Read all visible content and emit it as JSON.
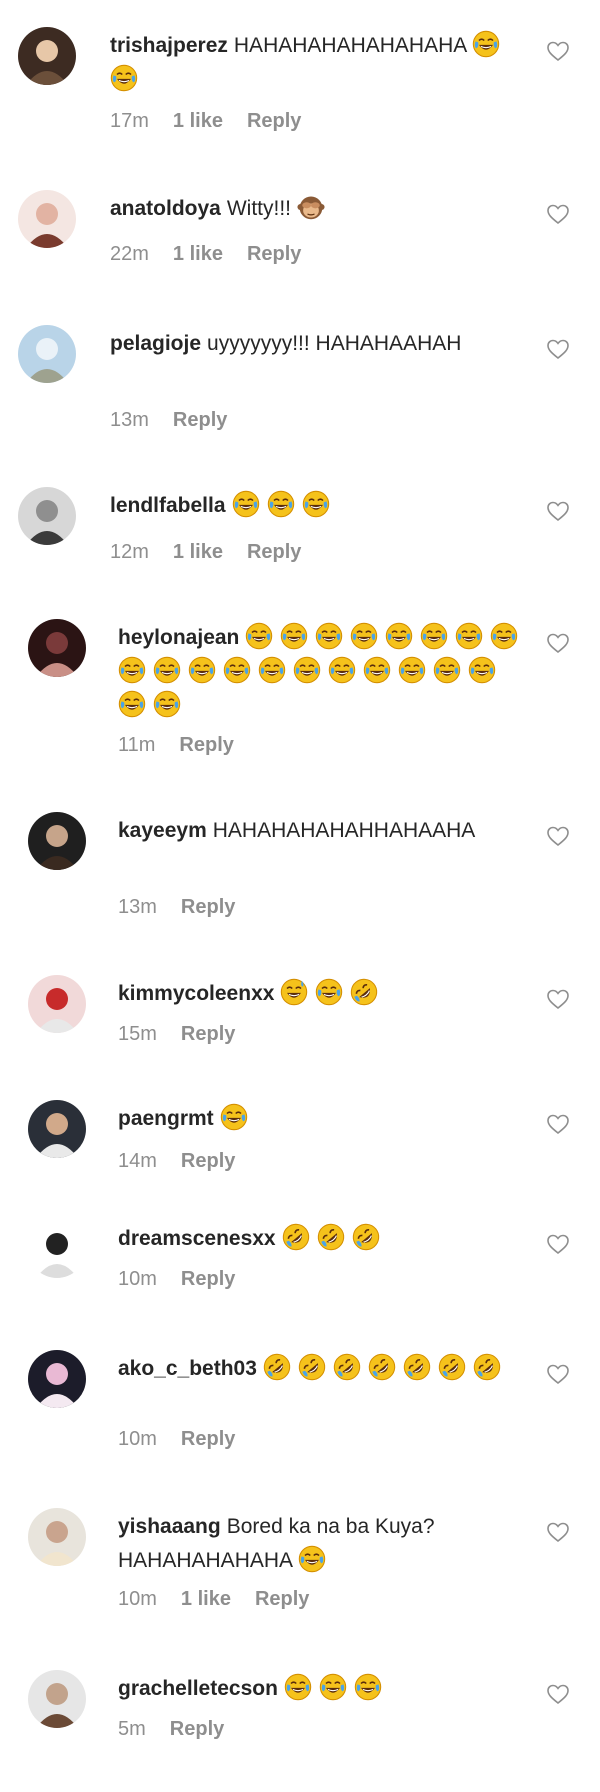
{
  "colors": {
    "text": "#262626",
    "meta": "#8e8e8e",
    "emoji_face": "#f5c21b",
    "emoji_outline": "#d48f00",
    "tear": "#4aa3e8"
  },
  "comments": [
    {
      "username": "trishajperez",
      "text": "HAHAHAHAHAHAHAHA",
      "emojis": [
        "joy",
        "joy"
      ],
      "time": "17m",
      "likes": "1 like",
      "reply": "Reply"
    },
    {
      "username": "anatoldoya",
      "text": "Witty!!!",
      "emojis": [
        "see-no-evil"
      ],
      "time": "22m",
      "likes": "1 like",
      "reply": "Reply"
    },
    {
      "username": "pelagioje",
      "text": "uyyyyyyy!!! HAHAHAAHAH",
      "emojis": [],
      "time": "13m",
      "likes": "",
      "reply": "Reply"
    },
    {
      "username": "lendlfabella",
      "text": "",
      "emojis": [
        "joy",
        "joy",
        "joy"
      ],
      "time": "12m",
      "likes": "1 like",
      "reply": "Reply"
    },
    {
      "username": "heylonajean",
      "text": "",
      "emojis": [
        "joy",
        "joy",
        "joy",
        "joy",
        "joy",
        "joy",
        "joy",
        "joy",
        "joy",
        "joy",
        "joy",
        "joy",
        "joy",
        "joy",
        "joy",
        "joy",
        "joy",
        "joy",
        "joy",
        "joy",
        "joy"
      ],
      "time": "11m",
      "likes": "",
      "reply": "Reply"
    },
    {
      "username": "kayeeym",
      "text": "HAHAHAHAHAHHAHAAHA",
      "emojis": [],
      "time": "13m",
      "likes": "",
      "reply": "Reply"
    },
    {
      "username": "kimmycoleenxx",
      "text": "",
      "emojis": [
        "sweat-smile",
        "joy",
        "rofl"
      ],
      "time": "15m",
      "likes": "",
      "reply": "Reply"
    },
    {
      "username": "paengrmt",
      "text": "",
      "emojis": [
        "joy"
      ],
      "time": "14m",
      "likes": "",
      "reply": "Reply"
    },
    {
      "username": "dreamscenesxx",
      "text": "",
      "emojis": [
        "rofl",
        "rofl",
        "rofl"
      ],
      "time": "10m",
      "likes": "",
      "reply": "Reply"
    },
    {
      "username": "ako_c_beth03",
      "text": "",
      "emojis": [
        "rofl",
        "rofl",
        "rofl",
        "rofl",
        "rofl",
        "rofl",
        "rofl"
      ],
      "time": "10m",
      "likes": "",
      "reply": "Reply"
    },
    {
      "username": "yishaaang",
      "text": "Bored ka na ba Kuya? HAHAHAHAHAHA",
      "emojis": [
        "joy"
      ],
      "time": "10m",
      "likes": "1 like",
      "reply": "Reply"
    },
    {
      "username": "grachelletecson",
      "text": "",
      "emojis": [
        "joy",
        "joy",
        "joy"
      ],
      "time": "5m",
      "likes": "",
      "reply": "Reply"
    }
  ]
}
